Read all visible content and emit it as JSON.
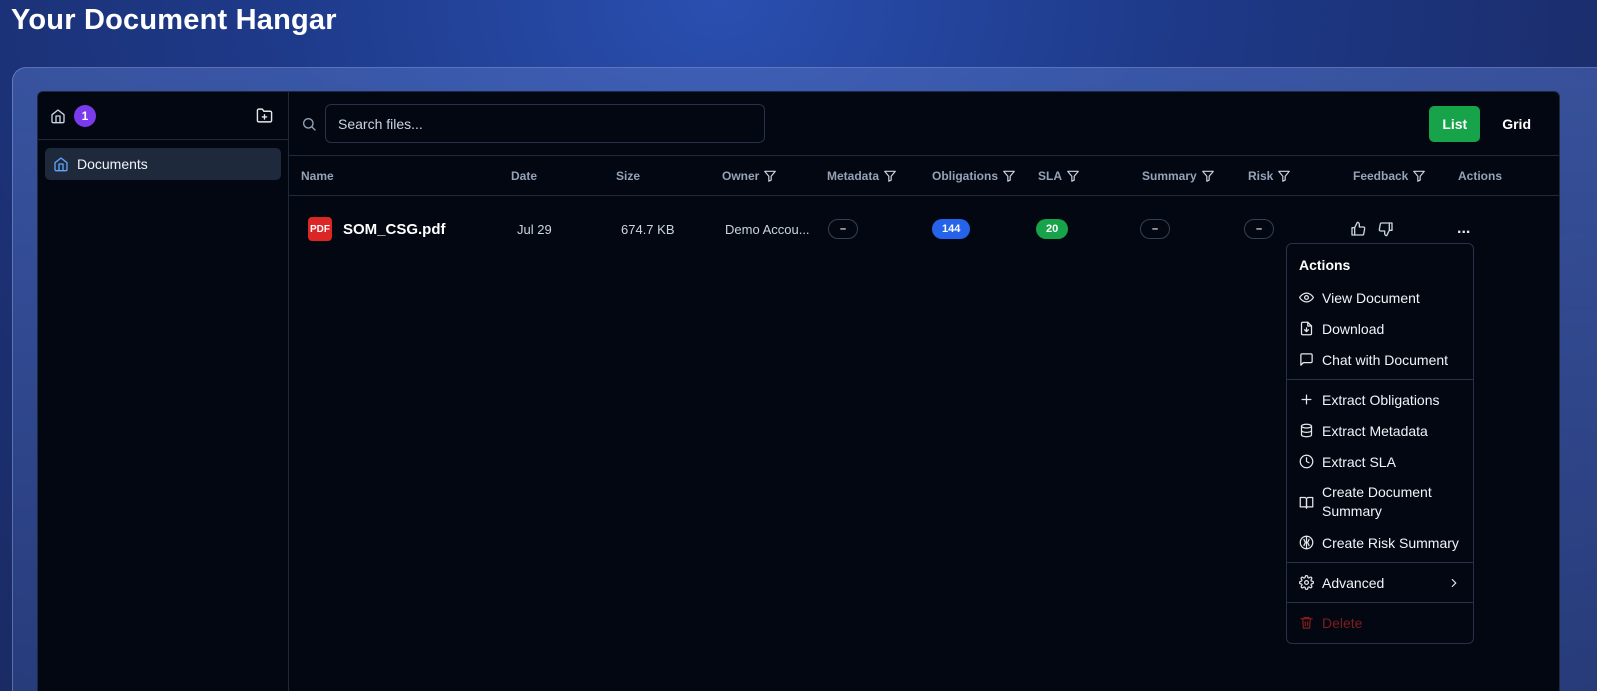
{
  "page": {
    "title": "Your Document Hangar"
  },
  "sidebar": {
    "count_badge": "1",
    "items": [
      {
        "label": "Documents"
      }
    ]
  },
  "toolbar": {
    "search_placeholder": "Search files...",
    "view_list": "List",
    "view_grid": "Grid",
    "active_view": "List"
  },
  "table": {
    "columns": [
      "Name",
      "Date",
      "Size",
      "Owner",
      "Metadata",
      "Obligations",
      "SLA",
      "Summary",
      "Risk",
      "Feedback",
      "Actions"
    ],
    "rows": [
      {
        "icon_label": "PDF",
        "name": "SOM_CSG.pdf",
        "date": "Jul 29",
        "size": "674.7 KB",
        "owner": "Demo Accou...",
        "metadata": "–",
        "obligations": "144",
        "sla": "20",
        "summary": "–",
        "risk": "–",
        "actions": "..."
      }
    ]
  },
  "actions_menu": {
    "title": "Actions",
    "items": [
      {
        "label": "View Document",
        "icon": "eye-icon"
      },
      {
        "label": "Download",
        "icon": "file-download-icon"
      },
      {
        "label": "Chat with Document",
        "icon": "message-square-icon"
      },
      {
        "label": "Extract Obligations",
        "icon": "plus-icon"
      },
      {
        "label": "Extract Metadata",
        "icon": "database-icon"
      },
      {
        "label": "Extract SLA",
        "icon": "clock-icon"
      },
      {
        "label": "Create Document Summary",
        "icon": "book-open-icon"
      },
      {
        "label": "Create Risk Summary",
        "icon": "brain-icon"
      },
      {
        "label": "Advanced",
        "icon": "gear-icon"
      },
      {
        "label": "Delete",
        "icon": "trash-icon"
      }
    ]
  },
  "colors": {
    "accent_green": "#16a34a",
    "badge_purple": "#7c3aed",
    "obligations_blue": "#2563eb",
    "pdf_red": "#dc2626",
    "delete_red": "#7f1d1d"
  }
}
